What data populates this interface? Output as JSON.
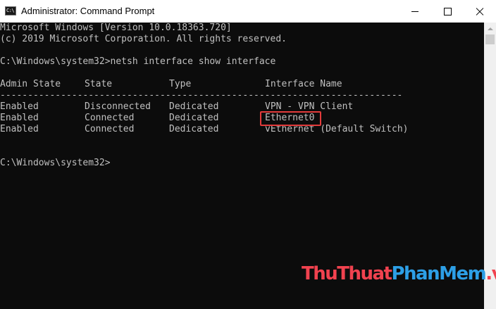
{
  "window": {
    "title": "Administrator: Command Prompt",
    "app_icon_text": "C:\\"
  },
  "console": {
    "header_lines": [
      "Microsoft Windows [Version 10.0.18363.720]",
      "(c) 2019 Microsoft Corporation. All rights reserved."
    ],
    "command_line": "C:\\Windows\\system32>netsh interface show interface",
    "table": {
      "columns": [
        "Admin State",
        "State",
        "Type",
        "Interface Name"
      ],
      "separator": "-------------------------------------------------------------------------",
      "rows": [
        [
          "Enabled",
          "Disconnected",
          "Dedicated",
          "VPN - VPN Client"
        ],
        [
          "Enabled",
          "Connected",
          "Dedicated",
          "Ethernet0"
        ],
        [
          "Enabled",
          "Connected",
          "Dedicated",
          "vEthernet (Default Switch)"
        ]
      ]
    },
    "prompt": "C:\\Windows\\system32>"
  },
  "highlight": {
    "target": "Ethernet0",
    "color": "#e33b3b"
  },
  "watermark": {
    "part1": "ThuThuat",
    "part2": "PhanMem",
    "part3": ".vn"
  },
  "colors": {
    "console_bg": "#0c0c0c",
    "console_text": "#c0c0c0",
    "watermark_red": "#f1424f",
    "watermark_blue": "#2d9fe6"
  },
  "icons": {
    "app": "command-prompt-icon",
    "minimize": "minimize-icon",
    "maximize": "maximize-icon",
    "close": "close-icon",
    "scroll_up": "scroll-up-arrow-icon"
  }
}
